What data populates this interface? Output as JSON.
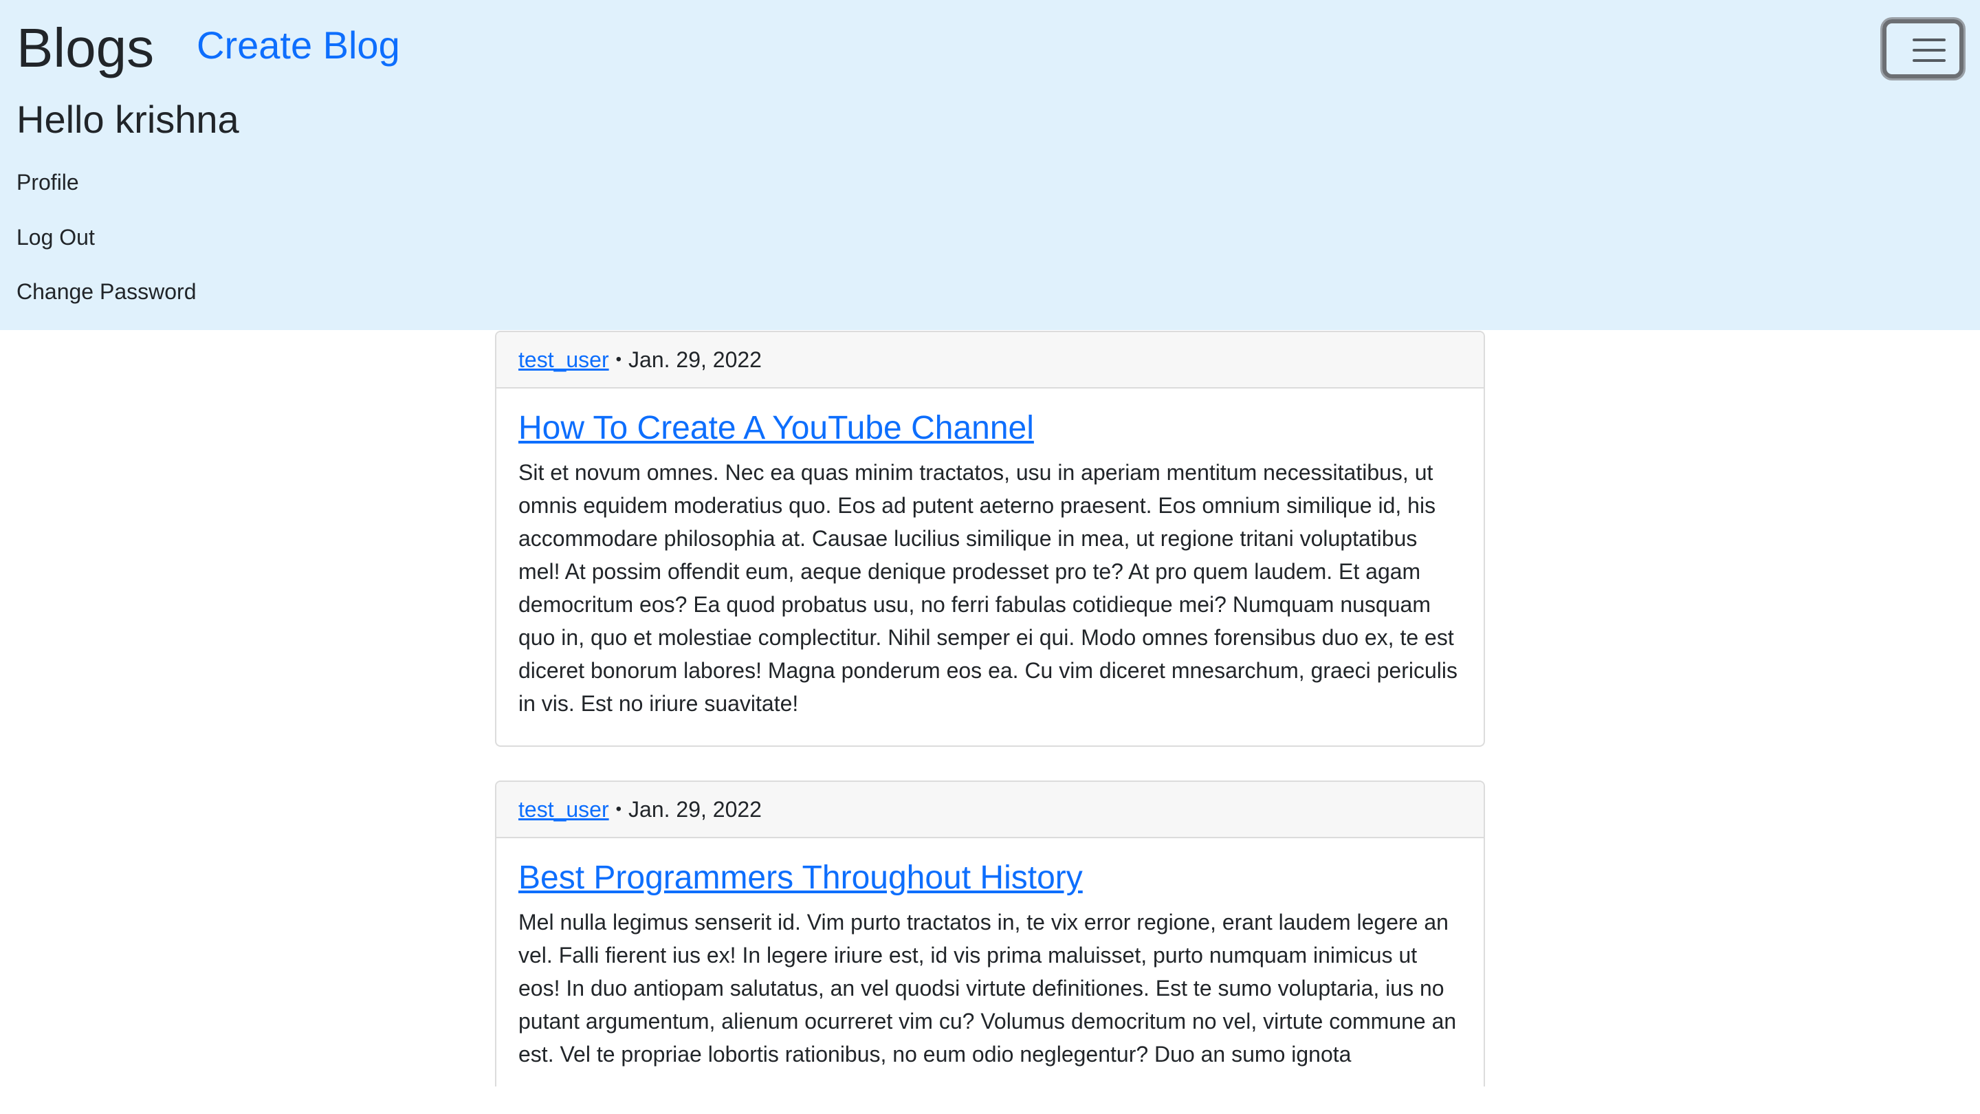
{
  "navbar": {
    "brand": "Blogs",
    "create_link": "Create Blog",
    "greeting": "Hello krishna",
    "links": [
      "Profile",
      "Log Out",
      "Change Password"
    ],
    "toggler_icon": "hamburger-menu-icon"
  },
  "posts": [
    {
      "author": "test_user",
      "separator": "•",
      "date": "Jan. 29, 2022",
      "title": "How To Create A YouTube Channel",
      "body": "Sit et novum omnes. Nec ea quas minim tractatos, usu in aperiam mentitum necessitatibus, ut omnis equidem moderatius quo. Eos ad putent aeterno praesent. Eos omnium similique id, his accommodare philosophia at. Causae lucilius similique in mea, ut regione tritani voluptatibus mel! At possim offendit eum, aeque denique prodesset pro te? At pro quem laudem. Et agam democritum eos? Ea quod probatus usu, no ferri fabulas cotidieque mei? Numquam nusquam quo in, quo et molestiae complectitur. Nihil semper ei qui. Modo omnes forensibus duo ex, te est diceret bonorum labores! Magna ponderum eos ea. Cu vim diceret mnesarchum, graeci periculis in vis. Est no iriure suavitate!"
    },
    {
      "author": "test_user",
      "separator": "•",
      "date": "Jan. 29, 2022",
      "title": "Best Programmers Throughout History",
      "body": "Mel nulla legimus senserit id. Vim purto tractatos in, te vix error regione, erant laudem legere an vel. Falli fierent ius ex! In legere iriure est, id vis prima maluisset, purto numquam inimicus ut eos! In duo antiopam salutatus, an vel quodsi virtute definitiones. Est te sumo voluptaria, ius no putant argumentum, alienum ocurreret vim cu? Volumus democritum no vel, virtute commune an est. Vel te propriae lobortis rationibus, no eum odio neglegentur? Duo an sumo ignota"
    }
  ],
  "colors": {
    "navbar_bg": "#e0f1fc",
    "link": "#0d6efd",
    "text": "#212529",
    "card_header_bg": "#f7f7f7",
    "card_border": "#dcdcdc"
  }
}
